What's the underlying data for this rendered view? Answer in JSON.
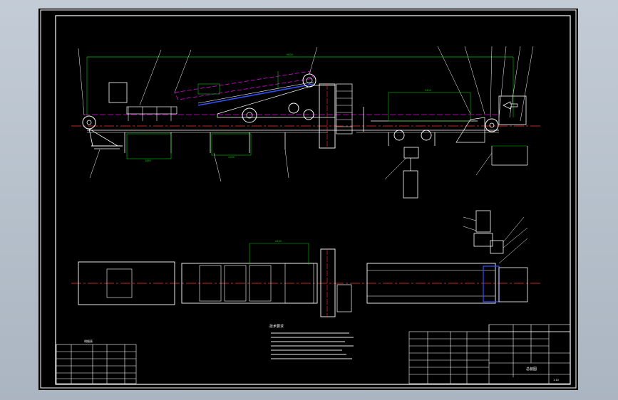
{
  "drawing": {
    "background": "#000000",
    "line_colors": {
      "frame": "#ffffff",
      "dimension": "#00c800",
      "centerline": "#ff3333",
      "hidden": "#e000e0",
      "part": "#ffffff",
      "cyan": "#00d0d0",
      "blue": "#3050ff",
      "yellow": "#e0e000"
    },
    "elevation_view": {
      "dim_overall": "9800",
      "dim_incline": "2400",
      "dim_head": "5400",
      "dim_left": "1840",
      "dim_mid": "2000"
    },
    "plan_view": {
      "dim_top": "2400"
    },
    "technical_requirements_title": "技术要求",
    "title_block": {
      "drawing_name": "总装图",
      "scale": "1:10"
    },
    "parts_list": {
      "header": "明细表"
    }
  }
}
